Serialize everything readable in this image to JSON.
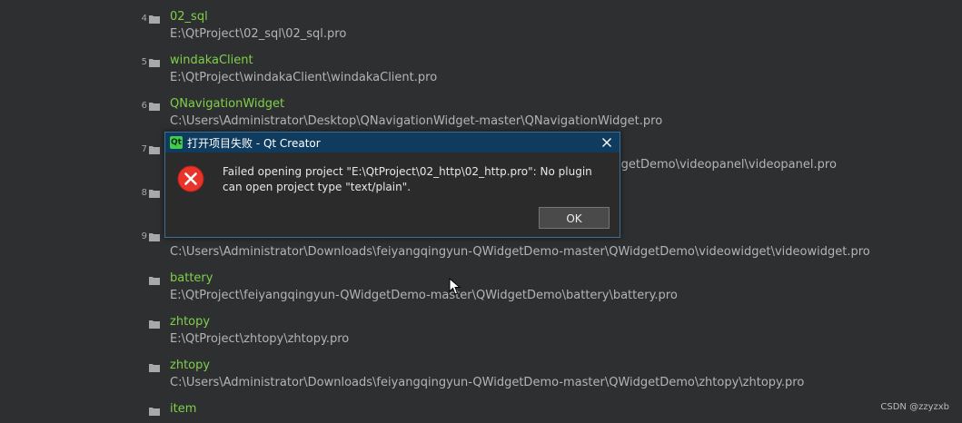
{
  "projects": [
    {
      "number": "4",
      "name": "02_sql",
      "path": "E:\\QtProject\\02_sql\\02_sql.pro"
    },
    {
      "number": "5",
      "name": "windakaClient",
      "path": "E:\\QtProject\\windakaClient\\windakaClient.pro"
    },
    {
      "number": "6",
      "name": "QNavigationWidget",
      "path": "C:\\Users\\Administrator\\Desktop\\QNavigationWidget-master\\QNavigationWidget.pro"
    },
    {
      "number": "7",
      "name": "",
      "path": "lgetDemo\\videopanel\\videopanel.pro"
    },
    {
      "number": "8",
      "name": "",
      "path": ""
    },
    {
      "number": "9",
      "name": "",
      "path": "C:\\Users\\Administrator\\Downloads\\feiyangqingyun-QWidgetDemo-master\\QWidgetDemo\\videowidget\\videowidget.pro"
    },
    {
      "number": "",
      "name": "battery",
      "path": "E:\\QtProject\\feiyangqingyun-QWidgetDemo-master\\QWidgetDemo\\battery\\battery.pro"
    },
    {
      "number": "",
      "name": "zhtopy",
      "path": "E:\\QtProject\\zhtopy\\zhtopy.pro"
    },
    {
      "number": "",
      "name": "zhtopy",
      "path": "C:\\Users\\Administrator\\Downloads\\feiyangqingyun-QWidgetDemo-master\\QWidgetDemo\\zhtopy\\zhtopy.pro"
    },
    {
      "number": "",
      "name": "item",
      "path": ""
    }
  ],
  "dialog": {
    "title": "打开项目失败 - Qt Creator",
    "app_icon_text": "Qt",
    "message": "Failed opening project \"E:\\QtProject\\02_http\\02_http.pro\": No plugin can open project type \"text/plain\".",
    "ok_label": "OK"
  },
  "watermark": "CSDN @zzyzxb",
  "colors": {
    "background": "#2e2f30",
    "project_name": "#7fd04a",
    "project_path": "#b4b4b4",
    "dialog_titlebar": "#0f3b5f",
    "error_red": "#e8352b"
  },
  "icons": {
    "folder": "folder-icon",
    "app": "qt-logo-icon",
    "close": "close-icon",
    "error": "error-icon",
    "cursor": "move-cursor-icon"
  }
}
